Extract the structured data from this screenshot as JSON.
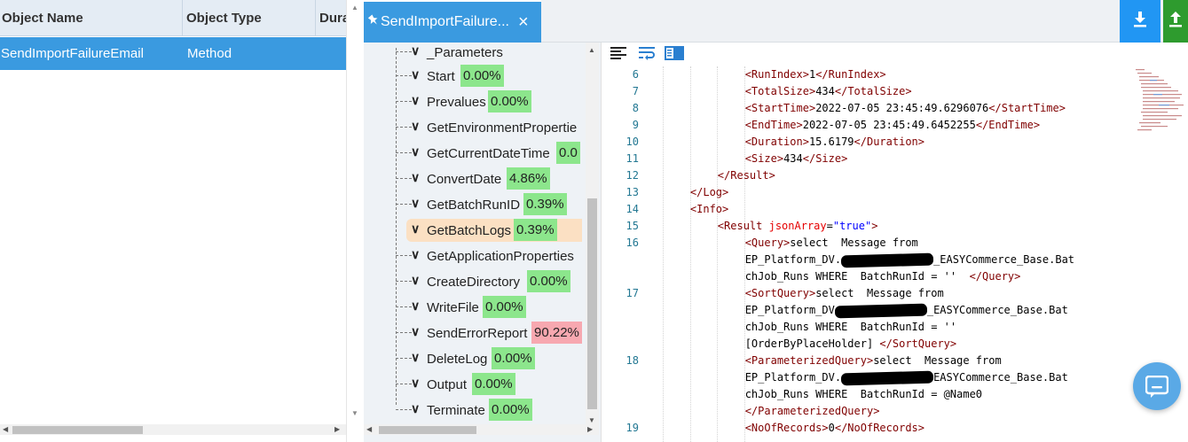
{
  "grid": {
    "columns": [
      "Object Name",
      "Object Type",
      "Dura"
    ],
    "rows": [
      {
        "name": "SendImportFailureEmail",
        "type": "Method"
      }
    ]
  },
  "tab": {
    "title": "SendImportFailure...",
    "close": "×"
  },
  "toolbar": {
    "download_icon": "download-icon",
    "upload_icon": "upload-icon",
    "download_color": "#2196f3",
    "upload_color": "#2e9b2e"
  },
  "tree": {
    "parameters_label": "_Parameters",
    "nodes": [
      {
        "label": "Start",
        "pct": "0.00%",
        "status": "green"
      },
      {
        "label": "Prevalues",
        "pct": "0.00%",
        "status": "green"
      },
      {
        "label": "GetEnvironmentPropertie",
        "pct": "",
        "status": "none"
      },
      {
        "label": "GetCurrentDateTime",
        "pct": "0.0",
        "status": "green"
      },
      {
        "label": "ConvertDate",
        "pct": "4.86%",
        "status": "green"
      },
      {
        "label": "GetBatchRunID",
        "pct": "0.39%",
        "status": "green"
      },
      {
        "label": "GetBatchLogs",
        "pct": "0.39%",
        "status": "green",
        "highlighted": true
      },
      {
        "label": "GetApplicationProperties",
        "pct": "",
        "status": "none"
      },
      {
        "label": "CreateDirectory",
        "pct": "0.00%",
        "status": "green"
      },
      {
        "label": "WriteFile",
        "pct": "0.00%",
        "status": "green"
      },
      {
        "label": "SendErrorReport",
        "pct": "90.22%",
        "status": "red"
      },
      {
        "label": "DeleteLog",
        "pct": "0.00%",
        "status": "green"
      },
      {
        "label": "Output",
        "pct": "0.00%",
        "status": "green"
      },
      {
        "label": "Terminate",
        "pct": "0.00%",
        "status": "green"
      }
    ]
  },
  "code": {
    "tools": [
      "align-left-icon",
      "word-wrap-icon",
      "panel-icon"
    ],
    "lines": [
      {
        "n": "6",
        "indent": 6,
        "parts": [
          [
            "tg",
            "<RunIndex>"
          ],
          [
            "tx",
            "1"
          ],
          [
            "tg",
            "</RunIndex>"
          ]
        ]
      },
      {
        "n": "7",
        "indent": 6,
        "parts": [
          [
            "tg",
            "<TotalSize>"
          ],
          [
            "tx",
            "434"
          ],
          [
            "tg",
            "</TotalSize>"
          ]
        ]
      },
      {
        "n": "8",
        "indent": 6,
        "parts": [
          [
            "tg",
            "<StartTime>"
          ],
          [
            "tx",
            "2022-07-05 23:45:49.6296076"
          ],
          [
            "tg",
            "</StartTime>"
          ]
        ]
      },
      {
        "n": "9",
        "indent": 6,
        "parts": [
          [
            "tg",
            "<EndTime>"
          ],
          [
            "tx",
            "2022-07-05 23:45:49.6452255"
          ],
          [
            "tg",
            "</EndTime>"
          ]
        ]
      },
      {
        "n": "10",
        "indent": 6,
        "parts": [
          [
            "tg",
            "<Duration>"
          ],
          [
            "tx",
            "15.6179"
          ],
          [
            "tg",
            "</Duration>"
          ]
        ]
      },
      {
        "n": "11",
        "indent": 6,
        "parts": [
          [
            "tg",
            "<Size>"
          ],
          [
            "tx",
            "434"
          ],
          [
            "tg",
            "</Size>"
          ]
        ]
      },
      {
        "n": "12",
        "indent": 4,
        "parts": [
          [
            "tg",
            "</Result>"
          ]
        ]
      },
      {
        "n": "13",
        "indent": 2,
        "parts": [
          [
            "tg",
            "</Log>"
          ]
        ]
      },
      {
        "n": "14",
        "indent": 2,
        "parts": [
          [
            "tg",
            "<Info>"
          ]
        ]
      },
      {
        "n": "15",
        "indent": 4,
        "parts": [
          [
            "tg",
            "<Result "
          ],
          [
            "at",
            "jsonArray"
          ],
          [
            "tx",
            "="
          ],
          [
            "av",
            "\"true\""
          ],
          [
            "tg",
            ">"
          ]
        ]
      },
      {
        "n": "16",
        "indent": 6,
        "parts": [
          [
            "tg",
            "<Query>"
          ],
          [
            "tx",
            "select  Message from"
          ]
        ]
      },
      {
        "n": "",
        "indent": 6,
        "parts": [
          [
            "tx",
            "EP_Platform_DV."
          ],
          [
            "rd",
            ""
          ],
          [
            "tx",
            "_EASYCommerce_Base.Bat"
          ]
        ]
      },
      {
        "n": "",
        "indent": 6,
        "parts": [
          [
            "tx",
            "chJob_Runs WHERE  BatchRunId = ''  "
          ],
          [
            "tg",
            "</Query>"
          ]
        ]
      },
      {
        "n": "17",
        "indent": 6,
        "parts": [
          [
            "tg",
            "<SortQuery>"
          ],
          [
            "tx",
            "select  Message from"
          ]
        ]
      },
      {
        "n": "",
        "indent": 6,
        "parts": [
          [
            "tx",
            "EP_Platform_DV"
          ],
          [
            "rd",
            ""
          ],
          [
            "tx",
            "_EASYCommerce_Base.Bat"
          ]
        ]
      },
      {
        "n": "",
        "indent": 6,
        "parts": [
          [
            "tx",
            "chJob_Runs WHERE  BatchRunId = ''"
          ]
        ]
      },
      {
        "n": "",
        "indent": 6,
        "parts": [
          [
            "tx",
            "[OrderByPlaceHolder] "
          ],
          [
            "tg",
            "</SortQuery>"
          ]
        ]
      },
      {
        "n": "18",
        "indent": 6,
        "parts": [
          [
            "tg",
            "<ParameterizedQuery>"
          ],
          [
            "tx",
            "select  Message from"
          ]
        ]
      },
      {
        "n": "",
        "indent": 6,
        "parts": [
          [
            "tx",
            "EP_Platform_DV."
          ],
          [
            "rd",
            ""
          ],
          [
            "tx",
            "EASYCommerce_Base.Bat"
          ]
        ]
      },
      {
        "n": "",
        "indent": 6,
        "parts": [
          [
            "tx",
            "chJob_Runs WHERE  BatchRunId = @Name0"
          ]
        ]
      },
      {
        "n": "",
        "indent": 6,
        "parts": [
          [
            "tg",
            "</ParameterizedQuery>"
          ]
        ]
      },
      {
        "n": "19",
        "indent": 6,
        "parts": [
          [
            "tg",
            "<NoOfRecords>"
          ],
          [
            "tx",
            "0"
          ],
          [
            "tg",
            "</NoOfRecords>"
          ]
        ]
      }
    ]
  },
  "chat": {
    "icon": "chat-icon",
    "color": "#5aa9e6"
  }
}
